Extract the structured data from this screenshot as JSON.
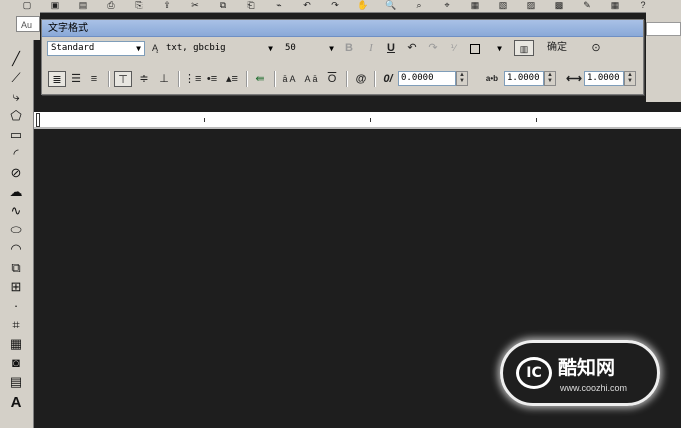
{
  "top_toolbar": {
    "icons": [
      "new-icon",
      "open-icon",
      "save-icon",
      "print-icon",
      "preview-icon",
      "publish-icon",
      "cut-icon",
      "copy-icon",
      "paste-icon",
      "match-icon",
      "undo-icon",
      "redo-icon",
      "pan-icon",
      "zoom-icon",
      "zoom-window-icon",
      "zoom-prev-icon",
      "properties-icon",
      "design-center-icon",
      "tool-palette-icon",
      "sheet-icon",
      "markup-icon",
      "calc-icon",
      "help-icon"
    ]
  },
  "au_tab": {
    "label": "Au"
  },
  "dialog": {
    "title": "文字格式",
    "style_select": "Standard",
    "font_select": "txt, gbcbig",
    "height_select": "50",
    "bold": "B",
    "italic": "I",
    "underline": "U",
    "ok_label": "确定",
    "oblique_value": "0.0000",
    "tracking_value": "1.0000",
    "width_value": "1.0000",
    "tracking_symbol": "a•b"
  },
  "watermark": {
    "brand": "酷知网",
    "url": "www.coozhi.com",
    "logo_text": "IC"
  }
}
